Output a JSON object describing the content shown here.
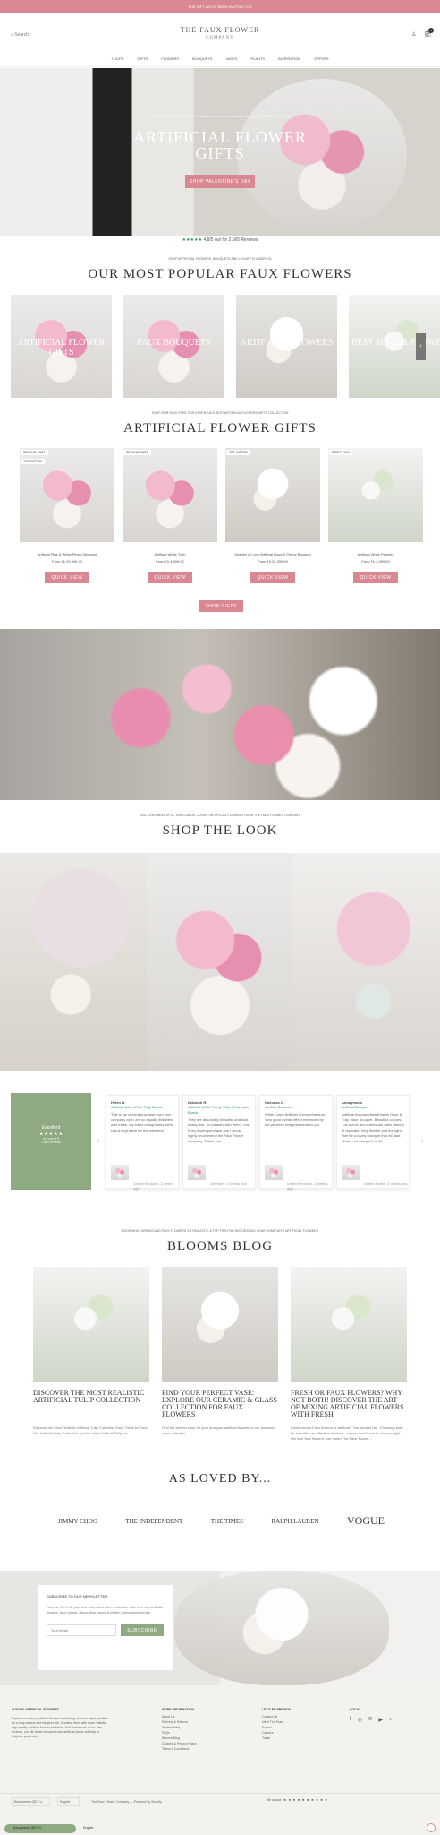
{
  "announcement": {
    "text": "THE GIFT WE'VE BEEN WAITING FOR"
  },
  "header": {
    "logo_top": "THE FAUX FLOWER",
    "logo_bottom": "COMPANY",
    "search": "Search",
    "cart_count": "0"
  },
  "nav": [
    "TULIPS",
    "GIFTS",
    "FLOWERS",
    "BOUQUETS",
    "VASES",
    "PLANTS",
    "INSPIRATION",
    "OFFERS"
  ],
  "hero": {
    "kicker": "SHOP LUXURY HANDMADE FAUX FLOWER ARTIFICIAL FLOWERS AND FLOWER ARRANGEMENTS ONLINE",
    "title_1": "ARTIFICIAL FLOWER",
    "title_2": "GIFTS",
    "button": "SHOP VALENTINE'S DAY"
  },
  "rating": {
    "text": "4.8/5 out for 2,565 Reviews",
    "stars": "★★★★★"
  },
  "popular": {
    "kicker": "SHOP ARTIFICIAL FLOWERS, BOUQUETS AND LUXURY FLOWERS IN",
    "title": "OUR MOST POPULAR FAUX FLOWERS",
    "items": [
      "ARTIFICIAL FLOWER GIFTS",
      "FAUX BOUQUETS",
      "ARTIFICIAL FLOWERS",
      "BEST SELLER FLOWER"
    ]
  },
  "gifts": {
    "kicker": "SHOP OUR FAUX FREE OUR ESSENTIALS BEST ARTIFICIAL FLOWERS GIFTS COLLECTION",
    "title": "ARTIFICIAL FLOWER GIFTS",
    "button": "SHOP GIFTS",
    "products": [
      {
        "badge1": "SELLING FAST",
        "badge2": "TOP GIFTED",
        "name": "Artificial Pink & White Peony Bouquet",
        "price": "From Tk 29,399.00",
        "button": "QUICK VIEW"
      },
      {
        "badge1": "SELLING FAST",
        "badge2": "",
        "name": "Artificial White Tulip",
        "price": "From Tk 3,599.00",
        "button": "QUICK VIEW"
      },
      {
        "badge1": "TOP GIFTED",
        "badge2": "",
        "name": "Shades of Love Artificial Rose & Peony Bouquet",
        "price": "From Tk 25,399.00",
        "button": "QUICK VIEW"
      },
      {
        "badge1": "STAFF PICK",
        "badge2": "",
        "name": "Artificial White Peonies",
        "price": "From Tk 2,999.00",
        "button": "QUICK VIEW"
      }
    ]
  },
  "look": {
    "kicker": "DISCOVER BEAUTIFUL, HAND-MADE, LUXURY ARTIFICIAL FLOWERS FROM THE FAUX FLOWER COMPANY",
    "title": "SHOP THE LOOK"
  },
  "reviews": {
    "overall": "Excellent",
    "stars": "★★★★★",
    "score": "4.8 out of 5",
    "count": "2,565 reviews",
    "items": [
      {
        "name": "Helen H.",
        "product": "Artificial Vase White Tulip Bunch",
        "text": "This is my second purchase from your company and I am so equally delighted with these. My sister thought they were real & kept them for the weekend.",
        "meta": "United Kingdom, 2 weeks ago"
      },
      {
        "name": "Deborah R.",
        "product": "Artificial White Peony Tulip & Lavender Bunch",
        "text": "They are absolutely beautiful and look totally real. So pleased with them. This is my fourth purchase and I would highly recommend the Faux Flower company. Thank you.",
        "meta": "Germany, 2 weeks ago"
      },
      {
        "name": "Nicholas C.",
        "product": "Verified Customer",
        "text": "White Large Artificial Chrysanthemum. Very good overall effect enhanced by the perfectly designed ceramic pot.",
        "meta": "United Kingdom, 2 weeks ago"
      },
      {
        "name": "Anonymous",
        "product": "Artificial Bouquet",
        "text": "Artificial Bougainvillea English Rose & Tulip Vase Bouquet. Beautiful colours. The bloom and leaves are often difficult to replicate. Very flexible and the right size for a lovely bouquet that will last. Would not change it at all.",
        "meta": "United States, 2 weeks ago"
      }
    ]
  },
  "blog": {
    "kicker": "BOOK WHAT BRINGS AND FAUX FLOWERS OR REALISTIC & TOP TIPS FOR DECORATING YOUR HOME WITH ARTIFICIAL FLOWERS",
    "title": "BLOOMS BLOG",
    "posts": [
      {
        "title": "DISCOVER THE MOST REALISTIC ARTIFICIAL TULIP COLLECTION",
        "text": "Discover the Most Realistic Artificial Tulip Collection Easy Tulips for Your Our Artificial Tulip Collection, by the Latest Artificial Tulips in..."
      },
      {
        "title": "FIND YOUR PERFECT VASE: EXPLORE OUR CERAMIC & GLASS COLLECTION FOR FAUX FLOWERS",
        "text": "Find the perfect vase for your and your artificial flowers, to our premium vase collection."
      },
      {
        "title": "FRESH OR FAUX FLOWERS? WHY NOT BOTH! DISCOVER THE ART OF MIXING ARTIFICIAL FLOWERS WITH FRESH",
        "text": "Fresh versus Faux flowers or artificial? You wouldn't be. Choosing both for beautiful, an effective decision - so you don't have to choose, right. We love faux flowers - we mean The Faux Flower..."
      }
    ]
  },
  "press": {
    "title": "AS LOVED BY...",
    "logos": [
      "JIMMY CHOO",
      "THE INDEPENDENT",
      "THE TIMES",
      "RALPH LAUREN",
      "VOGUE"
    ]
  },
  "newsletter": {
    "title": "SUBSCRIBE TO OUR NEWSLETTER",
    "text": "Receive 10% off your first order and other exclusive offers on our artificial flowers, faux plants, decorative vases & stylish home accessories.",
    "placeholder": "Your email",
    "button": "SUBSCRIBE"
  },
  "footer": {
    "col1_title": "LUXURY ARTIFICIAL FLOWERS",
    "col1_text": "Explore our luxury artificial flowers in stunning and true styles, perfect for a truly natural and elegant look. Creating them with most realistic, high-quality artificial flowers available. With thousands of five star reviews, our silk flower bouquets and artificial plants will help to brighten your home.",
    "col2_title": "MORE INFORMATION",
    "col2_links": [
      "About Us",
      "Delivery & Returns",
      "Sustainability",
      "FAQs",
      "Blooms Blog",
      "Cookies & Privacy Policy",
      "Terms & Conditions"
    ],
    "col3_title": "LET'S BE FRIENDS",
    "col3_links": [
      "Contact Us",
      "Meet The Team",
      "Events",
      "Careers",
      "Trade"
    ],
    "col4_title": "SOCIAL",
    "country": "Bangladesh (BDT ৳)",
    "language": "English",
    "copyright": "The Faux Flower Company — Powered by Shopify",
    "pay_label": "We accept"
  },
  "bottom_bar": {
    "country": "Bangladesh (BDT ৳)",
    "language": "English"
  }
}
